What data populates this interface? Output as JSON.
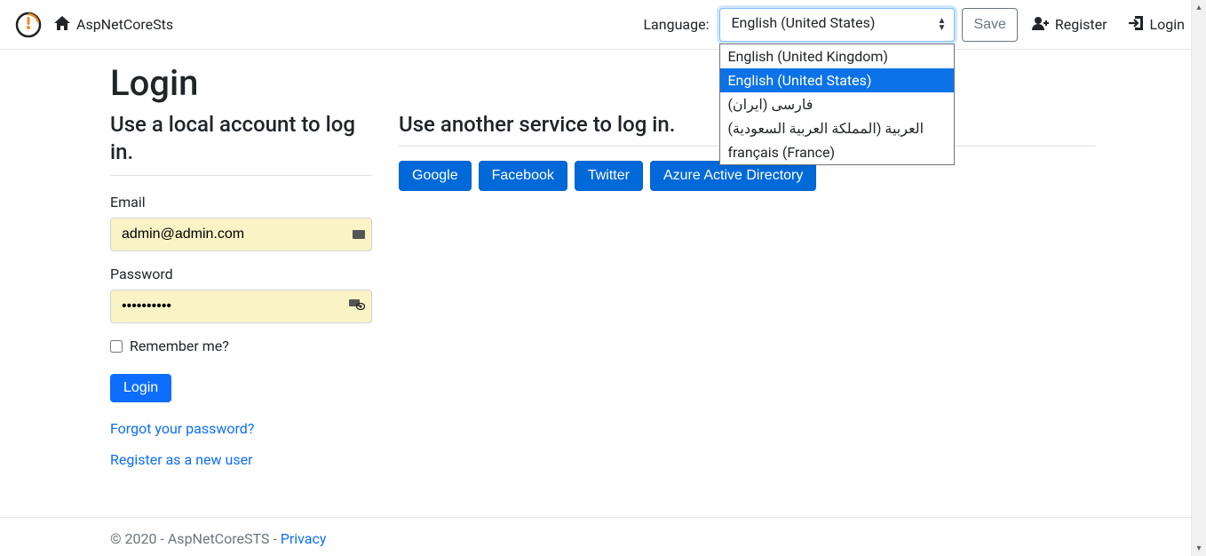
{
  "navbar": {
    "brand": "AspNetCoreSts",
    "language_label": "Language:",
    "language_selected": "English (United States)",
    "language_options": [
      "English (United Kingdom)",
      "English (United States)",
      "فارسی (ایران)",
      "العربية (المملكة العربية السعودية)",
      "français (France)"
    ],
    "save_label": "Save",
    "register_label": "Register",
    "login_label": "Login"
  },
  "login": {
    "title": "Login",
    "local_heading": "Use a local account to log in.",
    "email_label": "Email",
    "email_value": "admin@admin.com",
    "password_label": "Password",
    "password_value": "••••••••••",
    "remember_label": "Remember me?",
    "submit_label": "Login",
    "forgot_link": "Forgot your password?",
    "register_link": "Register as a new user"
  },
  "external": {
    "heading": "Use another service to log in.",
    "providers": [
      "Google",
      "Facebook",
      "Twitter",
      "Azure Active Directory"
    ]
  },
  "footer": {
    "text": "© 2020 - AspNetCoreSTS - ",
    "privacy": "Privacy"
  }
}
